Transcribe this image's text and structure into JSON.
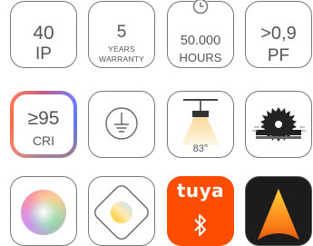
{
  "tiles": {
    "ip": {
      "value": "40",
      "unit": "IP"
    },
    "warranty": {
      "value": "5",
      "line1": "YEARS",
      "line2": "WARRANTY"
    },
    "lifetime": {
      "value": "50.000",
      "unit": "HOURS"
    },
    "power_factor": {
      "value": ">0,9",
      "unit": "PF"
    },
    "cri": {
      "value": "≥95",
      "unit": "CRI"
    },
    "beam_angle": {
      "value": "83°"
    },
    "tuya": {
      "brand": "tuya"
    }
  },
  "icons": [
    "ip-rating-icon",
    "warranty-icon",
    "lifetime-clock-icon",
    "power-factor-icon",
    "cri-rainbow-icon",
    "earth-ground-icon",
    "beam-angle-lamp-icon",
    "saw-blade-icon",
    "color-wheel-icon",
    "color-temperature-icon",
    "bluetooth-icon",
    "app-logo-icon"
  ],
  "colors": {
    "tile_border": "#777777",
    "text": "#555555",
    "tuya_orange": "#ff4d00"
  }
}
